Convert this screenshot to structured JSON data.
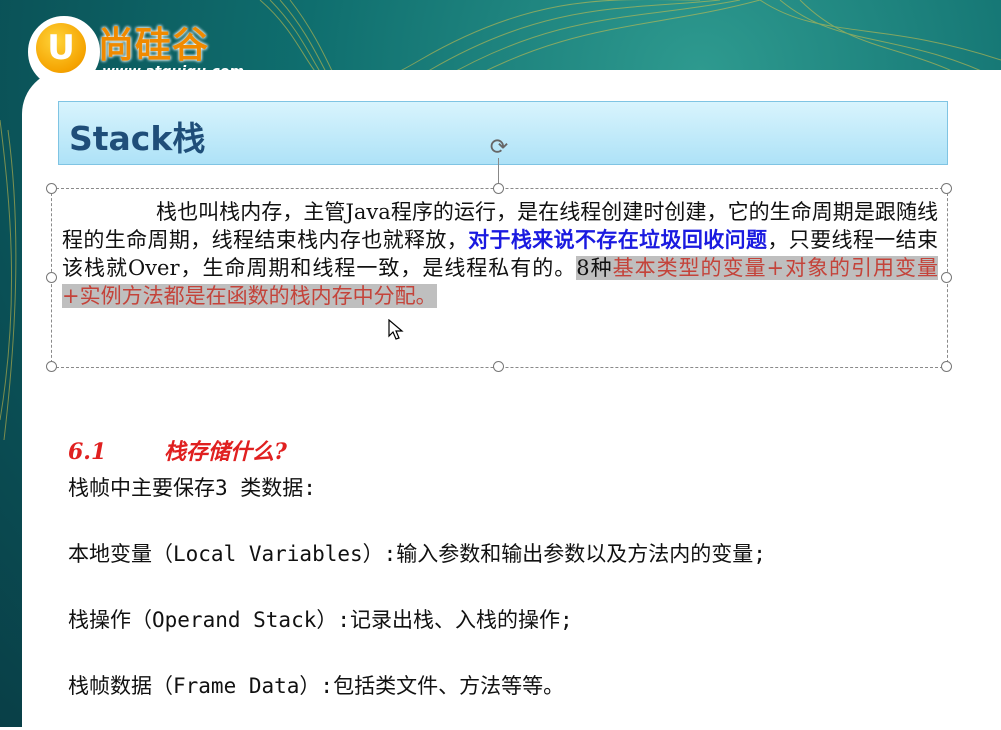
{
  "logo": {
    "letter": "U",
    "name": "尚硅谷",
    "url": "www.atguigu.com"
  },
  "slide": {
    "title": "Stack栈",
    "paragraph": {
      "part1": "栈也叫栈内存，主管Java程序的运行，是在线程创建时创建，它的生命周期是跟随线程的生命周期，线程结束栈内存也就释放，",
      "bold_blue": "对于栈来说不存在垃圾回收问题",
      "part2": "，只要线程一结束该栈就Over，生命周期和线程一致，是线程私有的。",
      "highlight_num": "8种",
      "highlight": "基本类型的变量+对象的引用变量+实例方法都是在函数的栈内存中分配。"
    },
    "section": {
      "number": "6.1",
      "title": "栈存储什么?"
    },
    "lines": [
      "栈帧中主要保存3 类数据:",
      "本地变量（Local Variables）:输入参数和输出参数以及方法内的变量;",
      "栈操作（Operand Stack）:记录出栈、入栈的操作;",
      "栈帧数据（Frame Data）:包括类文件、方法等等。"
    ]
  },
  "colors": {
    "title_text": "#1f4e79",
    "bold_blue": "#1a1ae0",
    "highlight_text": "#c4433a",
    "section_red": "#e02020",
    "logo_orange": "#f08a00"
  }
}
